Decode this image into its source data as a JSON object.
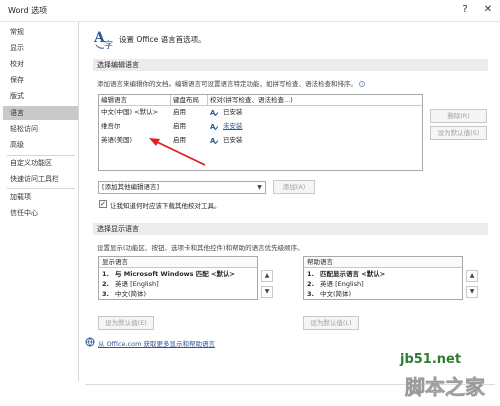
{
  "window": {
    "title": "Word 选项",
    "help_label": "?",
    "close_label": "✕"
  },
  "sidebar": {
    "items": [
      {
        "label": "常规"
      },
      {
        "label": "显示"
      },
      {
        "label": "校对"
      },
      {
        "label": "保存"
      },
      {
        "label": "版式"
      },
      {
        "label": "语言"
      },
      {
        "label": "轻松访问"
      },
      {
        "label": "高级"
      },
      {
        "label": "自定义功能区"
      },
      {
        "label": "快速访问工具栏"
      },
      {
        "label": "加载项"
      },
      {
        "label": "信任中心"
      }
    ],
    "selected_index": 5
  },
  "header": {
    "text": "设置 Office 语言首选项。",
    "icon": "language-icon"
  },
  "edit_section": {
    "title": "选择编辑语言",
    "description": "添加语言来编辑你的文档。编辑语言可设置语言特定功能，如拼写检查、语法检查和排序。",
    "columns": [
      "编辑语言",
      "键盘布局",
      "校对(拼写检查、语法检查...)"
    ],
    "rows": [
      {
        "language": "中文(中国) <默认>",
        "keyboard": "启用",
        "proofing": "已安装",
        "proof_is_link": false
      },
      {
        "language": "维吾尔",
        "keyboard": "启用",
        "proofing": "未安装",
        "proof_is_link": true
      },
      {
        "language": "英语(美国)",
        "keyboard": "启用",
        "proofing": "已安装",
        "proof_is_link": false
      }
    ],
    "remove_label": "删除(R)",
    "set_default_label": "设为默认值(S)",
    "add_dropdown_value": "[添加其他编辑语言]",
    "add_label": "添加(A)",
    "checkbox_label": "让我知道何时应该下载其他校对工具。",
    "checkbox_checked": true
  },
  "display_section": {
    "title": "选择显示语言",
    "description": "设置显示(功能区、按钮、选项卡和其他控件)和帮助的语言优先级顺序。",
    "display_header": "显示语言",
    "display_items": [
      {
        "num": "1.",
        "label": "与 Microsoft Windows 匹配 <默认>"
      },
      {
        "num": "2.",
        "label": "英语 [English]"
      },
      {
        "num": "3.",
        "label": "中文(简体)"
      }
    ],
    "help_header": "帮助语言",
    "help_items": [
      {
        "num": "1.",
        "label": "匹配显示语言 <默认>"
      },
      {
        "num": "2.",
        "label": "英语 [English]"
      },
      {
        "num": "3.",
        "label": "中文(简体)"
      }
    ],
    "display_set_default": "设为默认值(E)",
    "help_set_default": "设为默认值(L)",
    "up_arrow": "▲",
    "down_arrow": "▼",
    "link_text": "从 Office.com 获取更多显示和帮助语言"
  },
  "watermark": {
    "url": "jb51.net",
    "name": "脚本之家"
  },
  "colors": {
    "accent": "#2b5797",
    "selected_bg": "#c9c9c9",
    "annotation_arrow": "#e02020",
    "watermark_green": "#2e7d32"
  }
}
